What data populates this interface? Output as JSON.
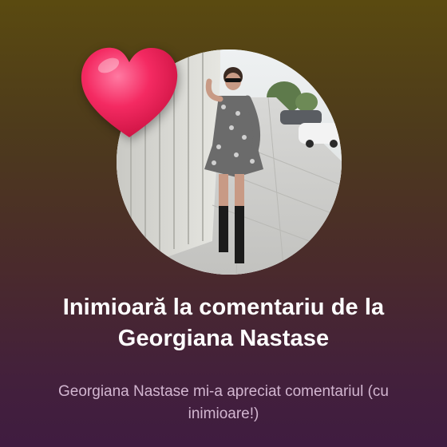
{
  "notification": {
    "title": "Inimioară la comentariu de la Georgiana Nastase",
    "subtitle": "Georgiana Nastase mi-a apreciat comentariul (cu inimioare!)"
  },
  "colors": {
    "heart": "#f0215d",
    "title_text": "#ffffff",
    "subtitle_text": "#d2b6d0"
  },
  "icons": {
    "heart": "heart-icon"
  }
}
